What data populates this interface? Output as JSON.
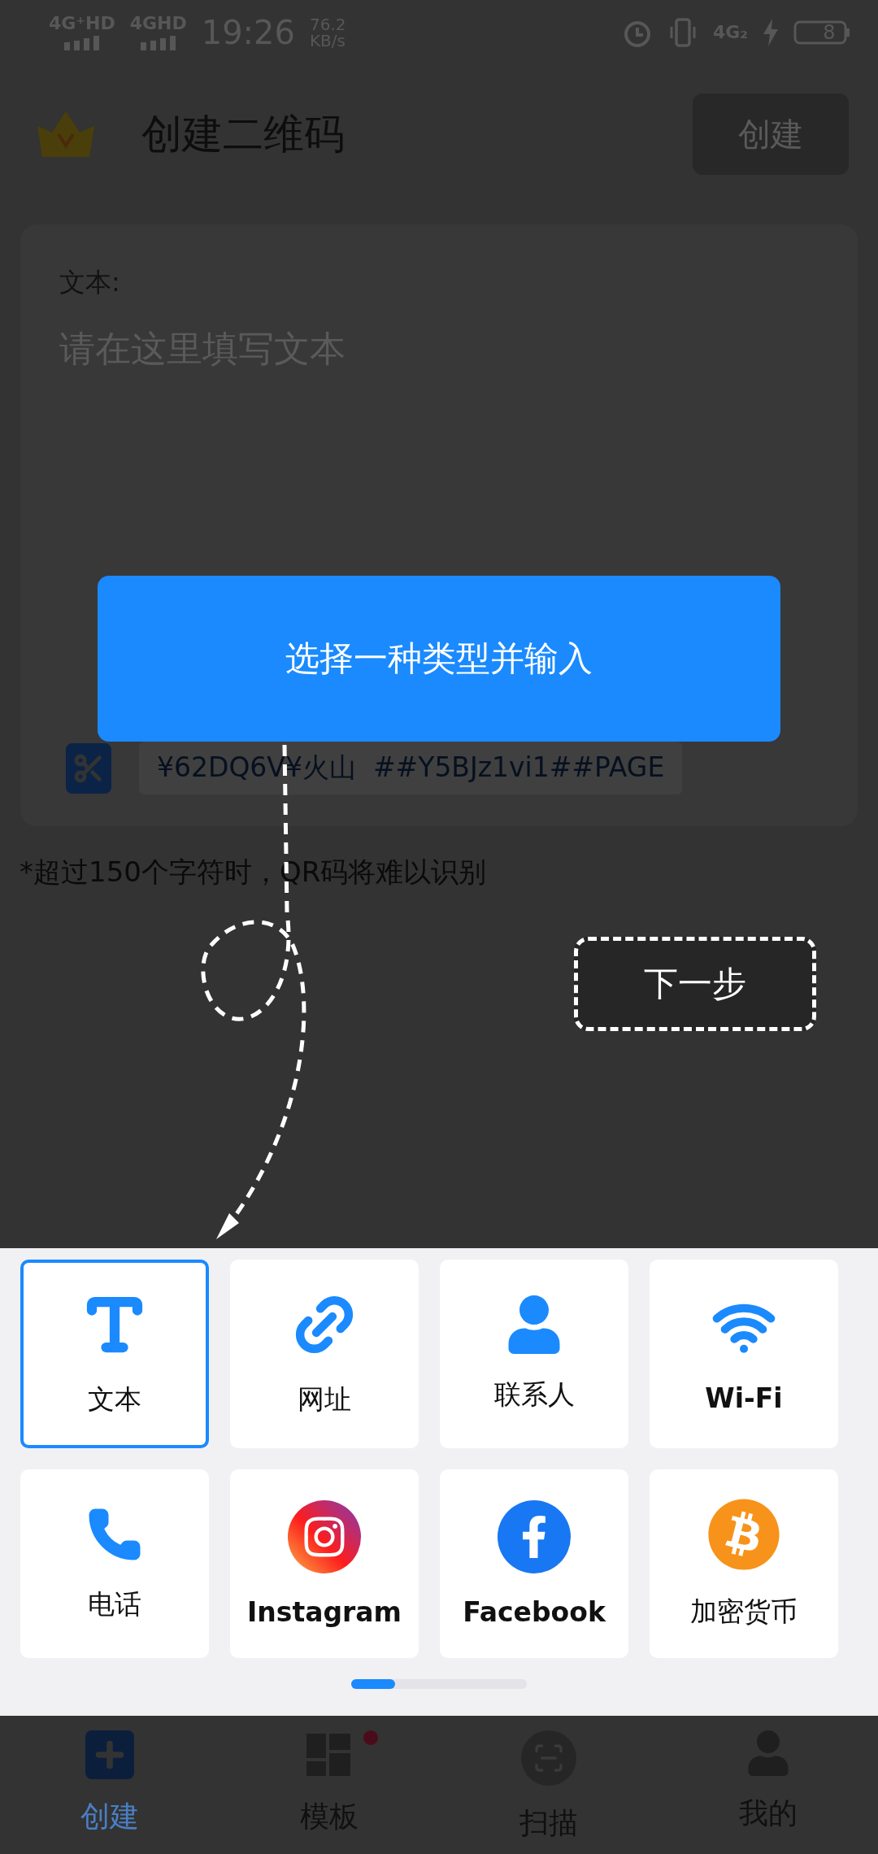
{
  "status_bar": {
    "signal_1": "4G⁺HD",
    "signal_2": "4GHD",
    "time": "19:26",
    "speed": "76.2",
    "speed_unit": "KB/s",
    "network": "4G₂",
    "battery": "8"
  },
  "header": {
    "title": "创建二维码",
    "create_button": "创建"
  },
  "text_card": {
    "label": "文本:",
    "placeholder": "请在这里填写文本",
    "clipboard": "¥62DQ6V¥火山  ##Y5BJz1vi1##PAGE"
  },
  "note": "*超过150个字符时，QR码将难以识别",
  "guide": {
    "tooltip": "选择一种类型并输入",
    "next_button": "下一步"
  },
  "types": [
    {
      "label": "文本",
      "selected": true
    },
    {
      "label": "网址",
      "selected": false
    },
    {
      "label": "联系人",
      "selected": false
    },
    {
      "label": "Wi-Fi",
      "selected": false
    },
    {
      "label": "电话",
      "selected": false
    },
    {
      "label": "Instagram",
      "selected": false
    },
    {
      "label": "Facebook",
      "selected": false
    },
    {
      "label": "加密货币",
      "selected": false
    }
  ],
  "bottom_nav": [
    {
      "label": "创建",
      "selected": true,
      "dot": false
    },
    {
      "label": "模板",
      "selected": false,
      "dot": true
    },
    {
      "label": "扫描",
      "selected": false,
      "dot": false
    },
    {
      "label": "我的",
      "selected": false,
      "dot": false
    }
  ]
}
